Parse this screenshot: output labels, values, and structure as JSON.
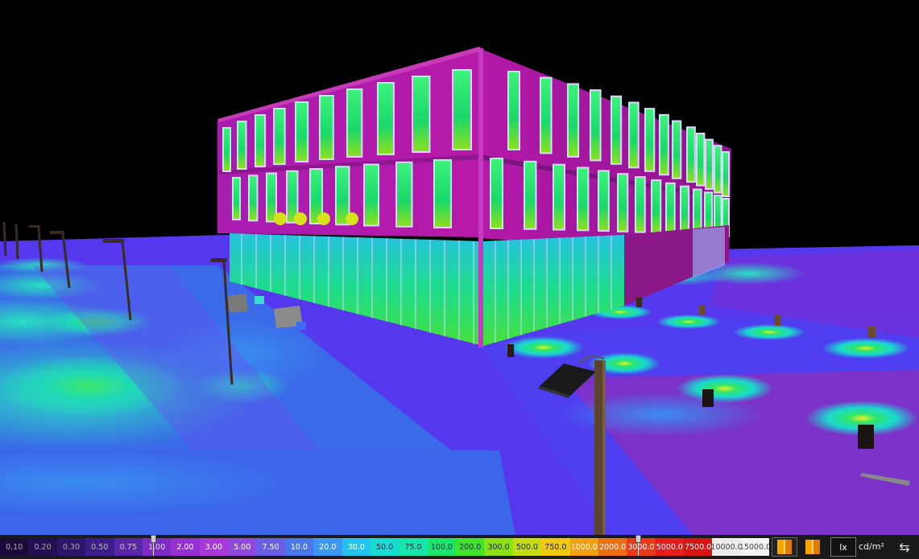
{
  "scene": {
    "description_icon": "3d-lighting-rendering"
  },
  "legend": {
    "values": [
      "0.10",
      "0.20",
      "0.30",
      "0.50",
      "0.75",
      "1.00",
      "2.00",
      "3.00",
      "5.00",
      "7.50",
      "10.0",
      "20.0",
      "30.0",
      "50.0",
      "75.0",
      "100.0",
      "200.0",
      "300.0",
      "500.0",
      "750.0",
      "1000.0",
      "2000.0",
      "3000.0",
      "5000.0",
      "7500.0",
      "10000.0",
      "15000.0"
    ],
    "colors": [
      "#1a0a3a",
      "#231054",
      "#2c166c",
      "#3c1e88",
      "#5a26a8",
      "#7a2cc4",
      "#9630d2",
      "#a838d8",
      "#9048dc",
      "#6a5ee4",
      "#4a78ec",
      "#3a98f0",
      "#22c4ee",
      "#18dcd2",
      "#16e6a8",
      "#1ae66a",
      "#40e22a",
      "#8ce014",
      "#c4dc10",
      "#f0c80e",
      "#f0a010",
      "#ee6e12",
      "#ea3a16",
      "#e41c1c",
      "#d61414",
      "#ececec",
      "#f4f4f4"
    ],
    "text_colors": [
      "#aaaaaa",
      "#aaaaaa",
      "#aaaaaa",
      "#bbbbbb",
      "#cccccc",
      "#dddddd",
      "#ffffff",
      "#ffffff",
      "#ffffff",
      "#ffffff",
      "#ffffff",
      "#ffffff",
      "#ffffff",
      "#1a2a4a",
      "#1a2a4a",
      "#1a2a4a",
      "#1a2a4a",
      "#1a2a4a",
      "#1a2a4a",
      "#1a2a4a",
      "#ffffff",
      "#ffffff",
      "#ffffff",
      "#ffffff",
      "#ffffff",
      "#444444",
      "#444444"
    ],
    "slider_min": "1.00",
    "slider_max": "3000.0"
  },
  "controls": {
    "palette_a_icon": "color-palette-icon",
    "palette_b_icon": "color-palette-alt-icon",
    "lx_label": "lx",
    "cd_label": "cd/m²",
    "swap_icon": "swap-arrows-icon"
  },
  "colors": {
    "ground_base": "#5a3cf2",
    "building": "#b01aa8",
    "window_green": "#1ee66a",
    "background": "#000000"
  }
}
